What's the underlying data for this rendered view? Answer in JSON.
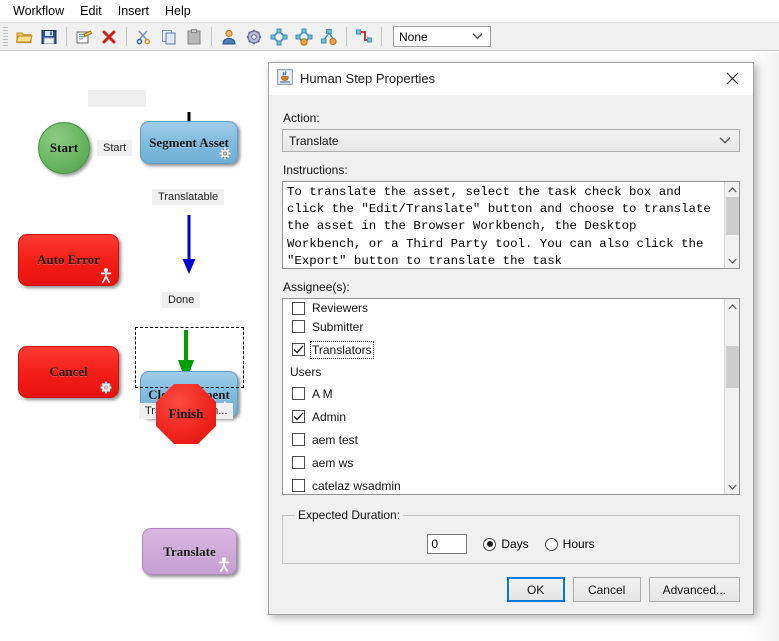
{
  "menubar": {
    "items": [
      {
        "label": "Workflow"
      },
      {
        "label": "Edit"
      },
      {
        "label": "Insert"
      },
      {
        "label": "Help"
      }
    ]
  },
  "toolbar": {
    "buttons": [
      {
        "icon": "open-folder-icon",
        "title": "Open"
      },
      {
        "icon": "save-disk-icon",
        "title": "Save"
      },
      {
        "icon": "properties-icon",
        "title": "Properties"
      },
      {
        "icon": "delete-x-icon",
        "title": "Delete"
      },
      {
        "icon": "cut-scissors-icon",
        "title": "Cut"
      },
      {
        "icon": "copy-pages-icon",
        "title": "Copy"
      },
      {
        "icon": "paste-clipboard-icon",
        "title": "Paste"
      },
      {
        "icon": "human-step-icon",
        "title": "Human Step"
      },
      {
        "icon": "gear-step-icon",
        "title": "Automatic Step"
      },
      {
        "icon": "subworkflow-icon",
        "title": "Sub Workflow"
      },
      {
        "icon": "subworkflow-auto-icon",
        "title": "Sub Workflow Auto"
      },
      {
        "icon": "decision-node-icon",
        "title": "Decision"
      },
      {
        "icon": "connector-icon",
        "title": "Connector"
      }
    ],
    "combo": {
      "value": "None",
      "arrow_icon": "chevron-down-icon"
    }
  },
  "workflow": {
    "nodes": [
      {
        "id": "start",
        "label": "Start",
        "shape": "circle",
        "color": "#66b45e",
        "glyph": "none"
      },
      {
        "id": "segment-asset",
        "label": "Segment Asset",
        "shape": "rounded",
        "color": "#7fb9dd",
        "glyph": "gear-icon"
      },
      {
        "id": "auto-error",
        "label": "Auto Error",
        "shape": "rounded",
        "color": "#f31c16",
        "glyph": "person-icon"
      },
      {
        "id": "cancel",
        "label": "Cancel",
        "shape": "rounded",
        "color": "#f31c16",
        "glyph": "gear-icon"
      },
      {
        "id": "clear-segment",
        "label": "Clear Segment",
        "shape": "rounded",
        "color": "#7fb9dd",
        "glyph": "gear-icon"
      },
      {
        "id": "translate",
        "label": "Translate",
        "shape": "rounded",
        "color": "#ceaad8",
        "glyph": "person-icon",
        "selected": true
      },
      {
        "id": "finish",
        "label": "Finish",
        "shape": "octagon",
        "color": "#ef231c",
        "glyph": "none"
      }
    ],
    "edges": [
      {
        "id": "start-edge",
        "label": "Start",
        "color": "#9a9a9a",
        "orientation": "horizontal"
      },
      {
        "id": "translatable-edge",
        "label": "Translatable",
        "color": "#000000",
        "orientation": "vertical"
      },
      {
        "id": "done-edge",
        "label": "Done",
        "color": "#0000d6",
        "orientation": "vertical"
      },
      {
        "id": "finish-edge",
        "label": "Translate > Fin...",
        "color": "#00a000",
        "orientation": "vertical"
      }
    ]
  },
  "dialog": {
    "title": "Human Step Properties",
    "title_icon": "java-app-icon",
    "close_icon": "close-icon",
    "action": {
      "label": "Action:",
      "value": "Translate",
      "arrow_icon": "chevron-down-icon"
    },
    "instructions": {
      "label": "Instructions:",
      "value": "To translate the asset, select the task check box and click the \"Edit/Translate\" button and choose to translate the asset in the Browser Workbench, the Desktop Workbench, or a Third Party tool. You can also click the \"Export\" button to translate the task",
      "scroll_up_icon": "chevron-up-icon",
      "scroll_down_icon": "chevron-down-icon"
    },
    "assignees": {
      "label": "Assignee(s):",
      "scroll_up_icon": "chevron-up-icon",
      "scroll_down_icon": "chevron-down-icon",
      "rows": [
        {
          "type": "check",
          "label": "Reviewers",
          "checked": false,
          "clipped": true
        },
        {
          "type": "check",
          "label": "Submitter",
          "checked": false
        },
        {
          "type": "check",
          "label": "Translators",
          "checked": true,
          "focused": true
        },
        {
          "type": "group",
          "label": "Users"
        },
        {
          "type": "check",
          "label": "A M",
          "checked": false
        },
        {
          "type": "check",
          "label": "Admin",
          "checked": true
        },
        {
          "type": "check",
          "label": "aem test",
          "checked": false
        },
        {
          "type": "check",
          "label": "aem ws",
          "checked": false
        },
        {
          "type": "check",
          "label": "catelaz wsadmin",
          "checked": false
        }
      ]
    },
    "duration": {
      "legend": "Expected Duration:",
      "value": "0",
      "options": [
        {
          "label": "Days",
          "selected": true
        },
        {
          "label": "Hours",
          "selected": false
        }
      ]
    },
    "buttons": [
      {
        "id": "ok",
        "label": "OK",
        "default": true
      },
      {
        "id": "cancel",
        "label": "Cancel",
        "default": false
      },
      {
        "id": "advanced",
        "label": "Advanced...",
        "default": false
      }
    ]
  }
}
